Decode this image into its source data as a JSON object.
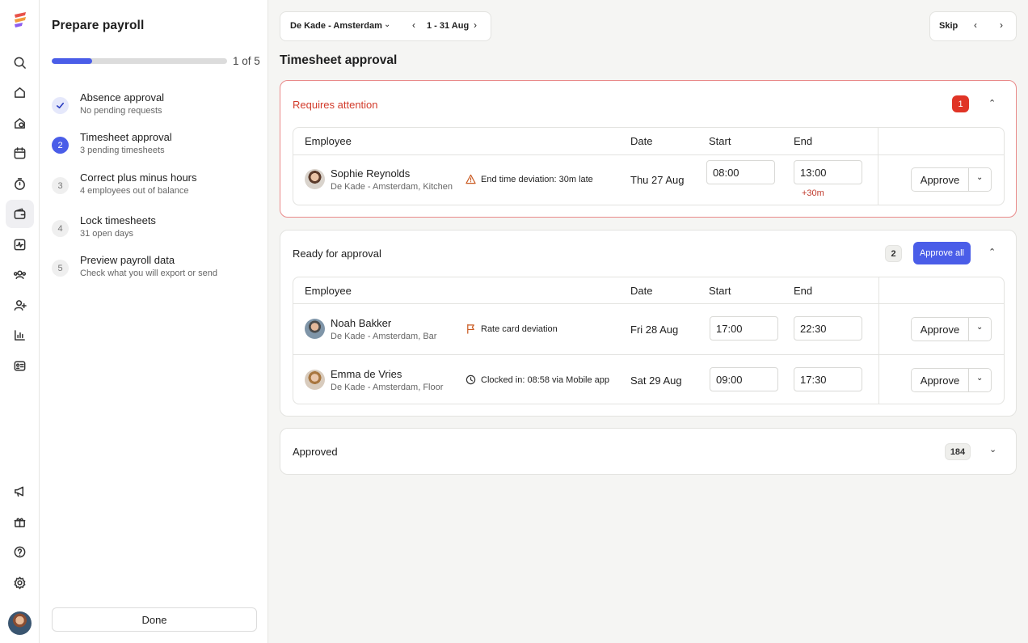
{
  "steps_panel": {
    "title": "Prepare payroll",
    "progress_text": "1 of 5",
    "progress": 0.23,
    "done_label": "Done",
    "items": [
      {
        "num": "",
        "title": "Absence approval",
        "sub": "No pending requests",
        "state": "done"
      },
      {
        "num": "2",
        "title": "Timesheet approval",
        "sub": "3 pending timesheets",
        "state": "current"
      },
      {
        "num": "3",
        "title": "Correct plus minus hours",
        "sub": "4 employees out of balance",
        "state": "todo"
      },
      {
        "num": "4",
        "title": "Lock timesheets",
        "sub": "31 open days",
        "state": "todo"
      },
      {
        "num": "5",
        "title": "Preview payroll data",
        "sub": "Check what you will export or send",
        "state": "todo"
      }
    ]
  },
  "topbar": {
    "location": "De Kade - Amsterdam",
    "range": "1 - 31 Aug",
    "skip": "Skip"
  },
  "page_title": "Timesheet approval",
  "columns": {
    "employee": "Employee",
    "date": "Date",
    "start": "Start",
    "end": "End"
  },
  "attention": {
    "title": "Requires attention",
    "count": "1",
    "rows": [
      {
        "name": "Sophie Reynolds",
        "location": "De Kade - Amsterdam, Kitchen",
        "note": "End time deviation: 30m late",
        "date": "Thu 27 Aug",
        "start": "08:00",
        "end": "13:00",
        "extra": "+30m",
        "approve": "Approve"
      }
    ]
  },
  "ready": {
    "title": "Ready for approval",
    "count": "2",
    "approve_all": "Approve all",
    "rows": [
      {
        "name": "Noah Bakker",
        "location": "De Kade - Amsterdam, Bar",
        "note": "Rate card deviation",
        "date": "Fri 28 Aug",
        "start": "17:00",
        "end": "22:30",
        "approve": "Approve"
      },
      {
        "name": "Emma de Vries",
        "location": "De Kade - Amsterdam, Floor",
        "note": "Clocked in: 08:58 via Mobile app",
        "date": "Sat 29 Aug",
        "start": "09:00",
        "end": "17:30",
        "approve": "Approve"
      }
    ]
  },
  "approved": {
    "title": "Approved",
    "count": "184"
  },
  "colors": {
    "accent": "#4a5de8",
    "danger": "#e03426",
    "attention_border": "#e98a8a",
    "warning_icon": "#c9581f"
  },
  "icons": {
    "rail": [
      "search-icon",
      "home-icon",
      "search-location-icon",
      "calendar-icon",
      "stopwatch-icon",
      "wallet-icon",
      "activity-icon",
      "team-icon",
      "add-user-icon",
      "bar-chart-icon",
      "id-card-icon",
      "megaphone-icon",
      "gift-icon",
      "help-icon",
      "settings-icon"
    ]
  }
}
